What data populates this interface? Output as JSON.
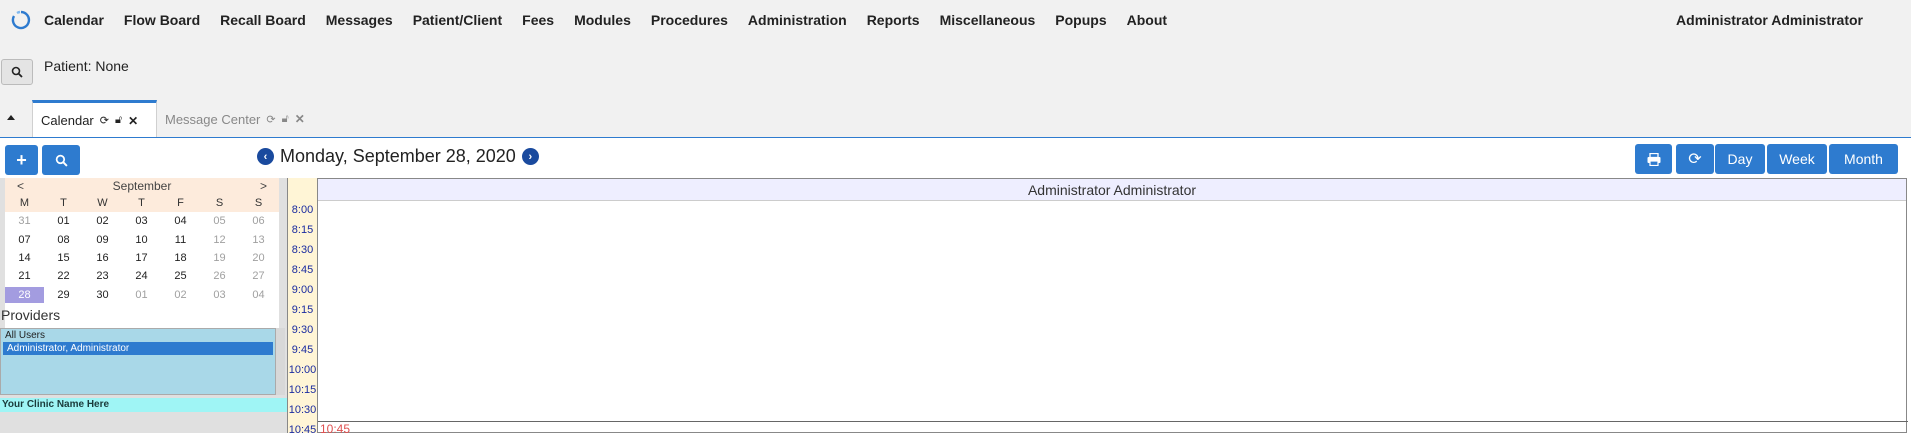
{
  "nav": {
    "items": [
      "Calendar",
      "Flow Board",
      "Recall Board",
      "Messages",
      "Patient/Client",
      "Fees",
      "Modules",
      "Procedures",
      "Administration",
      "Reports",
      "Miscellaneous",
      "Popups",
      "About"
    ],
    "user": "Administrator Administrator"
  },
  "patient": {
    "label": "Patient: None"
  },
  "tabs": [
    {
      "label": "Calendar",
      "active": true
    },
    {
      "label": "Message Center",
      "active": false
    }
  ],
  "toolbar": {
    "date_title": "Monday, September 28, 2020",
    "day_label": "Day",
    "week_label": "Week",
    "month_label": "Month"
  },
  "minical": {
    "prev": "<",
    "month": "September",
    "next": ">",
    "dow": [
      "M",
      "T",
      "W",
      "T",
      "F",
      "S",
      "S"
    ],
    "weeks": [
      [
        "31",
        "01",
        "02",
        "03",
        "04",
        "05",
        "06"
      ],
      [
        "07",
        "08",
        "09",
        "10",
        "11",
        "12",
        "13"
      ],
      [
        "14",
        "15",
        "16",
        "17",
        "18",
        "19",
        "20"
      ],
      [
        "21",
        "22",
        "23",
        "24",
        "25",
        "26",
        "27"
      ],
      [
        "28",
        "29",
        "30",
        "01",
        "02",
        "03",
        "04"
      ]
    ],
    "today": "28"
  },
  "providers": {
    "label": "Providers",
    "options": [
      "All Users",
      "Administrator, Administrator"
    ],
    "selected": "Administrator, Administrator"
  },
  "clinic": {
    "name": "Your Clinic Name Here"
  },
  "times": [
    "8:00",
    "8:15",
    "8:30",
    "8:45",
    "9:00",
    "9:15",
    "9:30",
    "9:45",
    "10:00",
    "10:15",
    "10:30",
    "10:45"
  ],
  "provider_column": {
    "header": "Administrator Administrator",
    "slot_label": "10:45"
  },
  "colors": {
    "accent": "#2e7bcf",
    "today": "#a39ce0",
    "time_text": "#1a2ba0"
  }
}
